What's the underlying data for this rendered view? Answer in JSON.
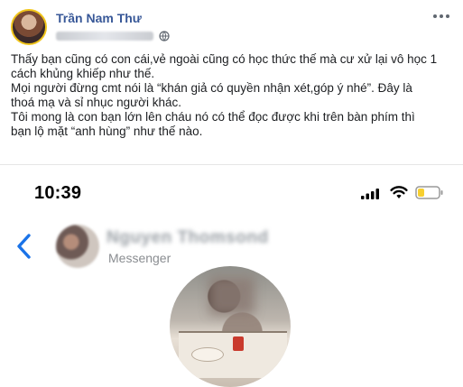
{
  "post": {
    "author": "Trần Nam Thư",
    "lines": [
      "Thấy bạn cũng có con cái,vẻ ngoài cũng có học thức thế mà cư xử lại vô học 1",
      "cách khủng khiếp như thế.",
      "Mọi người đừng cmt nói là “khán giả có quyền nhận xét,góp ý nhé”. Đây là",
      "thoá mạ và sỉ nhục người khác.",
      "Tôi mong là con bạn lớn lên cháu nó có thể đọc được khi trên bàn phím thì",
      "bạn lộ mặt “anh hùng” như thế nào."
    ]
  },
  "screenshot": {
    "time": "10:39",
    "contact_name": "Nguyen Thomsond",
    "channel": "Messenger"
  },
  "colors": {
    "author": "#385898",
    "text": "#1c1e21",
    "back": "#1a73e8",
    "battery": "#f7cf2f"
  },
  "icons": [
    "globe-icon",
    "more-icon",
    "signal-icon",
    "wifi-icon",
    "battery-icon",
    "back-chevron-icon"
  ]
}
